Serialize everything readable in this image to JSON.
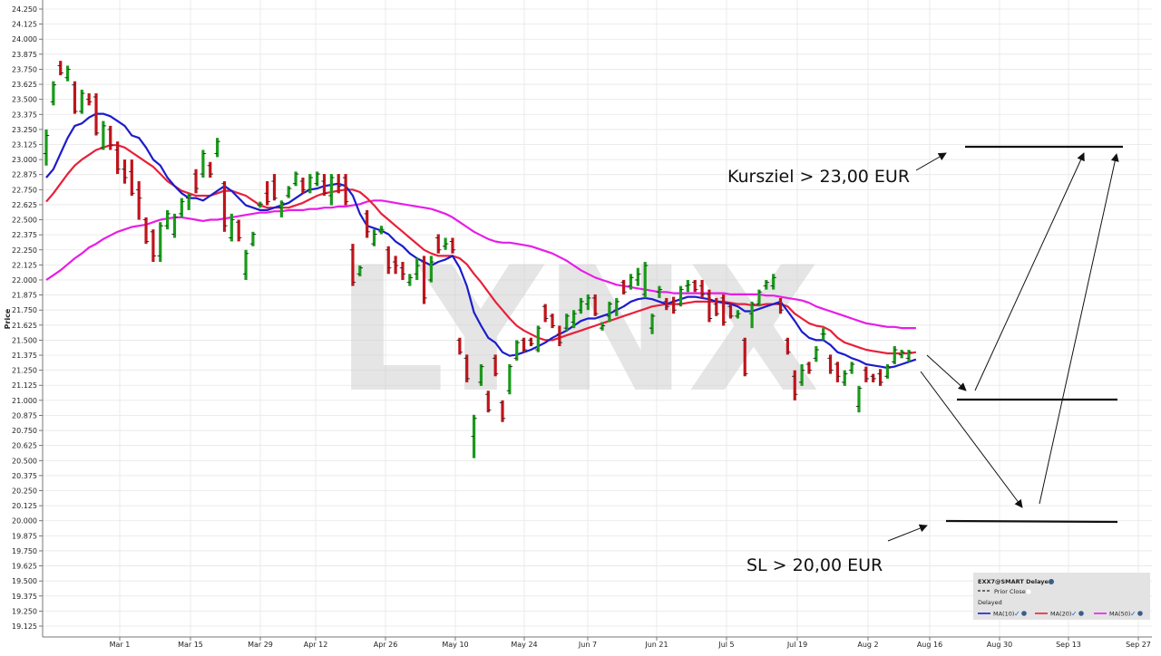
{
  "chart_data": {
    "type": "bar",
    "subtype": "ohlc",
    "watermark": "LYNX",
    "ylabel": "Price",
    "ylim": [
      19.125,
      24.25
    ],
    "y_ticks": [
      "24.250",
      "24.125",
      "24.000",
      "23.875",
      "23.750",
      "23.625",
      "23.500",
      "23.375",
      "23.250",
      "23.125",
      "23.000",
      "22.875",
      "22.750",
      "22.625",
      "22.500",
      "22.375",
      "22.250",
      "22.125",
      "22.000",
      "21.875",
      "21.750",
      "21.625",
      "21.500",
      "21.375",
      "21.250",
      "21.125",
      "21.000",
      "20.875",
      "20.750",
      "20.625",
      "20.500",
      "20.375",
      "20.250",
      "20.125",
      "20.000",
      "19.875",
      "19.750",
      "19.625",
      "19.500",
      "19.375",
      "19.250",
      "19.125"
    ],
    "x_ticks": [
      "Mar 1",
      "Mar 15",
      "Mar 29",
      "Apr 12",
      "Apr 26",
      "May 10",
      "May 24",
      "Jun 7",
      "Jun 21",
      "Jul 5",
      "Jul 19",
      "Aug 2",
      "Aug 16",
      "Aug 30",
      "Sep 13",
      "Sep 27"
    ],
    "up_color": "#1a9a1a",
    "down_color": "#c0141c",
    "bars": [
      {
        "o": 23.05,
        "h": 23.25,
        "l": 22.95,
        "c": 23.2
      },
      {
        "o": 23.48,
        "h": 23.65,
        "l": 23.45,
        "c": 23.62
      },
      {
        "o": 23.78,
        "h": 23.82,
        "l": 23.7,
        "c": 23.72
      },
      {
        "o": 23.68,
        "h": 23.78,
        "l": 23.65,
        "c": 23.75
      },
      {
        "o": 23.62,
        "h": 23.65,
        "l": 23.38,
        "c": 23.4
      },
      {
        "o": 23.4,
        "h": 23.58,
        "l": 23.38,
        "c": 23.55
      },
      {
        "o": 23.5,
        "h": 23.55,
        "l": 23.45,
        "c": 23.48
      },
      {
        "o": 23.52,
        "h": 23.55,
        "l": 23.2,
        "c": 23.22
      },
      {
        "o": 23.1,
        "h": 23.32,
        "l": 23.08,
        "c": 23.28
      },
      {
        "o": 23.25,
        "h": 23.28,
        "l": 23.08,
        "c": 23.12
      },
      {
        "o": 23.08,
        "h": 23.15,
        "l": 22.88,
        "c": 22.92
      },
      {
        "o": 22.92,
        "h": 23.0,
        "l": 22.8,
        "c": 22.85
      },
      {
        "o": 22.9,
        "h": 23.0,
        "l": 22.7,
        "c": 22.72
      },
      {
        "o": 22.75,
        "h": 22.82,
        "l": 22.5,
        "c": 22.68
      },
      {
        "o": 22.5,
        "h": 22.52,
        "l": 22.3,
        "c": 22.32
      },
      {
        "o": 22.4,
        "h": 22.42,
        "l": 22.15,
        "c": 22.2
      },
      {
        "o": 22.2,
        "h": 22.48,
        "l": 22.15,
        "c": 22.45
      },
      {
        "o": 22.45,
        "h": 22.58,
        "l": 22.42,
        "c": 22.55
      },
      {
        "o": 22.38,
        "h": 22.55,
        "l": 22.35,
        "c": 22.52
      },
      {
        "o": 22.55,
        "h": 22.68,
        "l": 22.52,
        "c": 22.65
      },
      {
        "o": 22.68,
        "h": 22.72,
        "l": 22.58,
        "c": 22.7
      },
      {
        "o": 22.88,
        "h": 22.92,
        "l": 22.72,
        "c": 22.76
      },
      {
        "o": 22.88,
        "h": 23.08,
        "l": 22.85,
        "c": 23.05
      },
      {
        "o": 22.95,
        "h": 22.98,
        "l": 22.85,
        "c": 22.88
      },
      {
        "o": 23.05,
        "h": 23.18,
        "l": 23.02,
        "c": 23.15
      },
      {
        "o": 22.8,
        "h": 22.82,
        "l": 22.4,
        "c": 22.45
      },
      {
        "o": 22.35,
        "h": 22.55,
        "l": 22.32,
        "c": 22.5
      },
      {
        "o": 22.48,
        "h": 22.5,
        "l": 22.32,
        "c": 22.35
      },
      {
        "o": 22.05,
        "h": 22.25,
        "l": 22.0,
        "c": 22.22
      },
      {
        "o": 22.3,
        "h": 22.4,
        "l": 22.28,
        "c": 22.38
      },
      {
        "o": 22.62,
        "h": 22.65,
        "l": 22.6,
        "c": 22.63
      },
      {
        "o": 22.72,
        "h": 22.82,
        "l": 22.62,
        "c": 22.65
      },
      {
        "o": 22.82,
        "h": 22.88,
        "l": 22.66,
        "c": 22.68
      },
      {
        "o": 22.6,
        "h": 22.66,
        "l": 22.52,
        "c": 22.64
      },
      {
        "o": 22.7,
        "h": 22.78,
        "l": 22.68,
        "c": 22.76
      },
      {
        "o": 22.8,
        "h": 22.9,
        "l": 22.78,
        "c": 22.88
      },
      {
        "o": 22.82,
        "h": 22.85,
        "l": 22.72,
        "c": 22.75
      },
      {
        "o": 22.75,
        "h": 22.88,
        "l": 22.72,
        "c": 22.85
      },
      {
        "o": 22.8,
        "h": 22.9,
        "l": 22.78,
        "c": 22.88
      },
      {
        "o": 22.82,
        "h": 22.88,
        "l": 22.7,
        "c": 22.72
      },
      {
        "o": 22.7,
        "h": 22.88,
        "l": 22.62,
        "c": 22.85
      },
      {
        "o": 22.8,
        "h": 22.88,
        "l": 22.72,
        "c": 22.78
      },
      {
        "o": 22.85,
        "h": 22.88,
        "l": 22.62,
        "c": 22.65
      },
      {
        "o": 22.25,
        "h": 22.3,
        "l": 21.95,
        "c": 21.98
      },
      {
        "o": 22.05,
        "h": 22.12,
        "l": 22.03,
        "c": 22.1
      },
      {
        "o": 22.55,
        "h": 22.58,
        "l": 22.35,
        "c": 22.4
      },
      {
        "o": 22.3,
        "h": 22.42,
        "l": 22.28,
        "c": 22.38
      },
      {
        "o": 22.4,
        "h": 22.45,
        "l": 22.38,
        "c": 22.42
      },
      {
        "o": 22.25,
        "h": 22.28,
        "l": 22.05,
        "c": 22.1
      },
      {
        "o": 22.15,
        "h": 22.2,
        "l": 22.05,
        "c": 22.12
      },
      {
        "o": 22.1,
        "h": 22.15,
        "l": 22.0,
        "c": 22.05
      },
      {
        "o": 21.98,
        "h": 22.05,
        "l": 21.95,
        "c": 22.02
      },
      {
        "o": 22.05,
        "h": 22.18,
        "l": 22.0,
        "c": 22.12
      },
      {
        "o": 22.15,
        "h": 22.2,
        "l": 21.8,
        "c": 21.85
      },
      {
        "o": 22.0,
        "h": 22.2,
        "l": 21.98,
        "c": 22.15
      },
      {
        "o": 22.35,
        "h": 22.38,
        "l": 22.22,
        "c": 22.25
      },
      {
        "o": 22.28,
        "h": 22.35,
        "l": 22.25,
        "c": 22.3
      },
      {
        "o": 22.32,
        "h": 22.35,
        "l": 22.22,
        "c": 22.25
      },
      {
        "o": 21.5,
        "h": 21.52,
        "l": 21.38,
        "c": 21.4
      },
      {
        "o": 21.35,
        "h": 21.38,
        "l": 21.15,
        "c": 21.18
      },
      {
        "o": 20.7,
        "h": 20.88,
        "l": 20.52,
        "c": 20.85
      },
      {
        "o": 21.15,
        "h": 21.3,
        "l": 21.12,
        "c": 21.28
      },
      {
        "o": 21.05,
        "h": 21.08,
        "l": 20.9,
        "c": 20.92
      },
      {
        "o": 21.35,
        "h": 21.38,
        "l": 21.2,
        "c": 21.22
      },
      {
        "o": 20.98,
        "h": 21.0,
        "l": 20.82,
        "c": 20.85
      },
      {
        "o": 21.08,
        "h": 21.3,
        "l": 21.05,
        "c": 21.28
      },
      {
        "o": 21.35,
        "h": 21.5,
        "l": 21.33,
        "c": 21.48
      },
      {
        "o": 21.5,
        "h": 21.52,
        "l": 21.4,
        "c": 21.42
      },
      {
        "o": 21.5,
        "h": 21.52,
        "l": 21.45,
        "c": 21.47
      },
      {
        "o": 21.42,
        "h": 21.62,
        "l": 21.4,
        "c": 21.6
      },
      {
        "o": 21.78,
        "h": 21.8,
        "l": 21.65,
        "c": 21.68
      },
      {
        "o": 21.7,
        "h": 21.72,
        "l": 21.6,
        "c": 21.62
      },
      {
        "o": 21.55,
        "h": 21.62,
        "l": 21.45,
        "c": 21.48
      },
      {
        "o": 21.6,
        "h": 21.72,
        "l": 21.58,
        "c": 21.7
      },
      {
        "o": 21.65,
        "h": 21.75,
        "l": 21.6,
        "c": 21.72
      },
      {
        "o": 21.75,
        "h": 21.85,
        "l": 21.72,
        "c": 21.82
      },
      {
        "o": 21.8,
        "h": 21.88,
        "l": 21.75,
        "c": 21.85
      },
      {
        "o": 21.85,
        "h": 21.88,
        "l": 21.7,
        "c": 21.72
      },
      {
        "o": 21.6,
        "h": 21.65,
        "l": 21.58,
        "c": 21.62
      },
      {
        "o": 21.7,
        "h": 21.82,
        "l": 21.65,
        "c": 21.8
      },
      {
        "o": 21.75,
        "h": 21.85,
        "l": 21.7,
        "c": 21.82
      },
      {
        "o": 21.98,
        "h": 22.0,
        "l": 21.88,
        "c": 21.9
      },
      {
        "o": 21.95,
        "h": 22.05,
        "l": 21.92,
        "c": 22.02
      },
      {
        "o": 22.0,
        "h": 22.1,
        "l": 21.95,
        "c": 22.05
      },
      {
        "o": 21.88,
        "h": 22.15,
        "l": 21.85,
        "c": 22.12
      },
      {
        "o": 21.6,
        "h": 21.72,
        "l": 21.55,
        "c": 21.7
      },
      {
        "o": 21.9,
        "h": 21.95,
        "l": 21.85,
        "c": 21.92
      },
      {
        "o": 21.82,
        "h": 21.85,
        "l": 21.75,
        "c": 21.78
      },
      {
        "o": 21.82,
        "h": 21.86,
        "l": 21.72,
        "c": 21.75
      },
      {
        "o": 21.8,
        "h": 21.95,
        "l": 21.78,
        "c": 21.92
      },
      {
        "o": 21.95,
        "h": 22.0,
        "l": 21.9,
        "c": 21.96
      },
      {
        "o": 21.98,
        "h": 22.0,
        "l": 21.9,
        "c": 21.92
      },
      {
        "o": 21.95,
        "h": 22.0,
        "l": 21.85,
        "c": 21.88
      },
      {
        "o": 21.88,
        "h": 21.92,
        "l": 21.65,
        "c": 21.68
      },
      {
        "o": 21.8,
        "h": 21.85,
        "l": 21.7,
        "c": 21.72
      },
      {
        "o": 21.85,
        "h": 21.88,
        "l": 21.62,
        "c": 21.65
      },
      {
        "o": 21.78,
        "h": 21.8,
        "l": 21.68,
        "c": 21.7
      },
      {
        "o": 21.7,
        "h": 21.75,
        "l": 21.68,
        "c": 21.72
      },
      {
        "o": 21.5,
        "h": 21.52,
        "l": 21.2,
        "c": 21.22
      },
      {
        "o": 21.72,
        "h": 21.82,
        "l": 21.6,
        "c": 21.8
      },
      {
        "o": 21.8,
        "h": 21.92,
        "l": 21.78,
        "c": 21.9
      },
      {
        "o": 21.95,
        "h": 22.0,
        "l": 21.92,
        "c": 21.98
      },
      {
        "o": 21.95,
        "h": 22.05,
        "l": 21.92,
        "c": 22.02
      },
      {
        "o": 21.8,
        "h": 21.85,
        "l": 21.72,
        "c": 21.75
      },
      {
        "o": 21.5,
        "h": 21.52,
        "l": 21.38,
        "c": 21.4
      },
      {
        "o": 21.2,
        "h": 21.25,
        "l": 21.0,
        "c": 21.05
      },
      {
        "o": 21.15,
        "h": 21.3,
        "l": 21.12,
        "c": 21.25
      },
      {
        "o": 21.3,
        "h": 21.32,
        "l": 21.22,
        "c": 21.25
      },
      {
        "o": 21.35,
        "h": 21.45,
        "l": 21.32,
        "c": 21.42
      },
      {
        "o": 21.55,
        "h": 21.6,
        "l": 21.5,
        "c": 21.55
      },
      {
        "o": 21.35,
        "h": 21.38,
        "l": 21.22,
        "c": 21.25
      },
      {
        "o": 21.3,
        "h": 21.32,
        "l": 21.15,
        "c": 21.2
      },
      {
        "o": 21.15,
        "h": 21.25,
        "l": 21.12,
        "c": 21.22
      },
      {
        "o": 21.25,
        "h": 21.32,
        "l": 21.22,
        "c": 21.3
      },
      {
        "o": 20.95,
        "h": 21.12,
        "l": 20.9,
        "c": 21.1
      },
      {
        "o": 21.25,
        "h": 21.28,
        "l": 21.15,
        "c": 21.18
      },
      {
        "o": 21.2,
        "h": 21.22,
        "l": 21.15,
        "c": 21.18
      },
      {
        "o": 21.22,
        "h": 21.26,
        "l": 21.12,
        "c": 21.15
      },
      {
        "o": 21.2,
        "h": 21.3,
        "l": 21.18,
        "c": 21.28
      },
      {
        "o": 21.32,
        "h": 21.45,
        "l": 21.3,
        "c": 21.42
      },
      {
        "o": 21.38,
        "h": 21.42,
        "l": 21.35,
        "c": 21.4
      },
      {
        "o": 21.35,
        "h": 21.42,
        "l": 21.32,
        "c": 21.4
      }
    ],
    "ma_labels": [
      "MA(10)",
      "MA(20)",
      "MA(50)"
    ],
    "ma_colors": [
      "#1c1ccc",
      "#e8203a",
      "#e81ce8"
    ],
    "ma10": [
      22.85,
      22.92,
      23.05,
      23.18,
      23.28,
      23.3,
      23.35,
      23.38,
      23.38,
      23.36,
      23.32,
      23.28,
      23.2,
      23.18,
      23.1,
      23.0,
      22.95,
      22.85,
      22.78,
      22.72,
      22.68,
      22.68,
      22.66,
      22.7,
      22.74,
      22.78,
      22.74,
      22.68,
      22.62,
      22.6,
      22.58,
      22.58,
      22.6,
      22.62,
      22.64,
      22.68,
      22.72,
      22.75,
      22.76,
      22.78,
      22.79,
      22.8,
      22.78,
      22.7,
      22.55,
      22.45,
      22.43,
      22.41,
      22.38,
      22.32,
      22.28,
      22.22,
      22.18,
      22.15,
      22.12,
      22.15,
      22.17,
      22.2,
      22.1,
      21.95,
      21.73,
      21.62,
      21.52,
      21.48,
      21.4,
      21.37,
      21.38,
      21.4,
      21.42,
      21.45,
      21.48,
      21.52,
      21.55,
      21.58,
      21.62,
      21.66,
      21.68,
      21.68,
      21.7,
      21.72,
      21.75,
      21.78,
      21.82,
      21.84,
      21.85,
      21.84,
      21.82,
      21.8,
      21.82,
      21.84,
      21.86,
      21.86,
      21.85,
      21.84,
      21.82,
      21.81,
      21.8,
      21.78,
      21.74,
      21.74,
      21.76,
      21.78,
      21.8,
      21.82,
      21.74,
      21.66,
      21.57,
      21.52,
      21.5,
      21.5,
      21.46,
      21.4,
      21.38,
      21.35,
      21.33,
      21.3,
      21.29,
      21.28,
      21.27,
      21.28,
      21.3,
      21.32,
      21.34
    ],
    "ma20": [
      22.65,
      22.72,
      22.8,
      22.88,
      22.95,
      23.0,
      23.04,
      23.08,
      23.1,
      23.12,
      23.12,
      23.1,
      23.06,
      23.02,
      22.98,
      22.94,
      22.88,
      22.82,
      22.78,
      22.74,
      22.72,
      22.7,
      22.7,
      22.7,
      22.72,
      22.74,
      22.74,
      22.72,
      22.7,
      22.66,
      22.62,
      22.6,
      22.6,
      22.6,
      22.6,
      22.62,
      22.64,
      22.67,
      22.7,
      22.72,
      22.73,
      22.74,
      22.75,
      22.75,
      22.73,
      22.68,
      22.62,
      22.55,
      22.5,
      22.45,
      22.4,
      22.35,
      22.3,
      22.25,
      22.22,
      22.2,
      22.2,
      22.2,
      22.18,
      22.13,
      22.05,
      21.98,
      21.9,
      21.82,
      21.75,
      21.68,
      21.62,
      21.58,
      21.55,
      21.52,
      21.5,
      21.5,
      21.52,
      21.54,
      21.56,
      21.58,
      21.6,
      21.62,
      21.64,
      21.66,
      21.68,
      21.7,
      21.72,
      21.74,
      21.76,
      21.78,
      21.79,
      21.8,
      21.8,
      21.8,
      21.81,
      21.82,
      21.82,
      21.82,
      21.82,
      21.82,
      21.81,
      21.8,
      21.8,
      21.79,
      21.79,
      21.8,
      21.8,
      21.8,
      21.78,
      21.72,
      21.68,
      21.64,
      21.62,
      21.61,
      21.58,
      21.52,
      21.48,
      21.46,
      21.44,
      21.42,
      21.41,
      21.4,
      21.39,
      21.39,
      21.39,
      21.39,
      21.4
    ],
    "ma50": [
      22.0,
      22.04,
      22.08,
      22.13,
      22.18,
      22.22,
      22.27,
      22.3,
      22.34,
      22.37,
      22.4,
      22.42,
      22.44,
      22.45,
      22.46,
      22.48,
      22.5,
      22.51,
      22.52,
      22.52,
      22.51,
      22.5,
      22.49,
      22.5,
      22.5,
      22.51,
      22.52,
      22.53,
      22.54,
      22.55,
      22.56,
      22.56,
      22.57,
      22.57,
      22.58,
      22.58,
      22.58,
      22.59,
      22.59,
      22.6,
      22.6,
      22.61,
      22.61,
      22.62,
      22.63,
      22.65,
      22.66,
      22.66,
      22.65,
      22.64,
      22.63,
      22.62,
      22.61,
      22.6,
      22.59,
      22.57,
      22.55,
      22.52,
      22.48,
      22.44,
      22.4,
      22.37,
      22.34,
      22.32,
      22.31,
      22.31,
      22.3,
      22.29,
      22.28,
      22.26,
      22.24,
      22.22,
      22.19,
      22.16,
      22.12,
      22.08,
      22.05,
      22.02,
      22.0,
      21.98,
      21.96,
      21.95,
      21.94,
      21.93,
      21.92,
      21.91,
      21.9,
      21.9,
      21.89,
      21.89,
      21.89,
      21.89,
      21.89,
      21.89,
      21.89,
      21.89,
      21.88,
      21.88,
      21.88,
      21.88,
      21.88,
      21.87,
      21.87,
      21.86,
      21.85,
      21.84,
      21.83,
      21.81,
      21.78,
      21.76,
      21.74,
      21.72,
      21.7,
      21.68,
      21.66,
      21.64,
      21.63,
      21.62,
      21.61,
      21.61,
      21.6,
      21.6,
      21.6
    ],
    "annotations": {
      "target_label": "Kursziel > 23,00 EUR",
      "stop_label": "SL > 20,00 EUR"
    },
    "legend": {
      "title": "EXX7@SMART Delayed",
      "prior_close": "Prior Close",
      "delayed": "Delayed"
    }
  }
}
